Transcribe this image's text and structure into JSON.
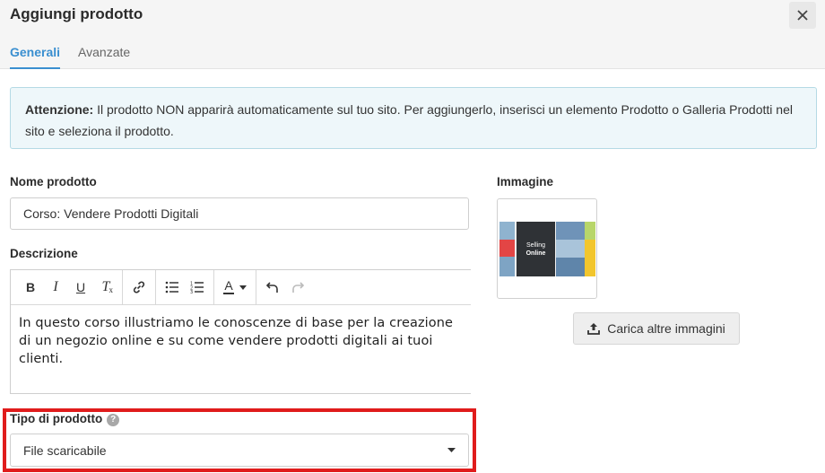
{
  "dialog": {
    "title": "Aggiungi prodotto"
  },
  "tabs": [
    {
      "label": "Generali",
      "active": true
    },
    {
      "label": "Avanzate",
      "active": false
    }
  ],
  "alert": {
    "strong": "Attenzione:",
    "text": " Il prodotto NON apparirà automaticamente sul tuo sito. Per aggiungerlo, inserisci un elemento Prodotto o Galleria Prodotti nel sito e seleziona il prodotto."
  },
  "form": {
    "name_label": "Nome prodotto",
    "name_value": "Corso: Vendere Prodotti Digitali",
    "description_label": "Descrizione",
    "description_text": "In questo corso illustriamo le conoscenze di base per la creazione di un negozio online e su come vendere prodotti digitali ai tuoi clienti.",
    "type_label": "Tipo di prodotto",
    "type_value": "File scaricabile",
    "image_label": "Immagine",
    "upload_label": "Carica altre immagini"
  },
  "thumbnail": {
    "text_line1": "Selling",
    "text_line2": "Online"
  },
  "toolbar": {
    "bold": "B",
    "italic": "I",
    "underline": "U",
    "clear": "T",
    "font_color": "A"
  },
  "colors": {
    "accent": "#3a8fd0",
    "highlight": "#e01c1c",
    "alert_bg": "#eef7fa"
  }
}
